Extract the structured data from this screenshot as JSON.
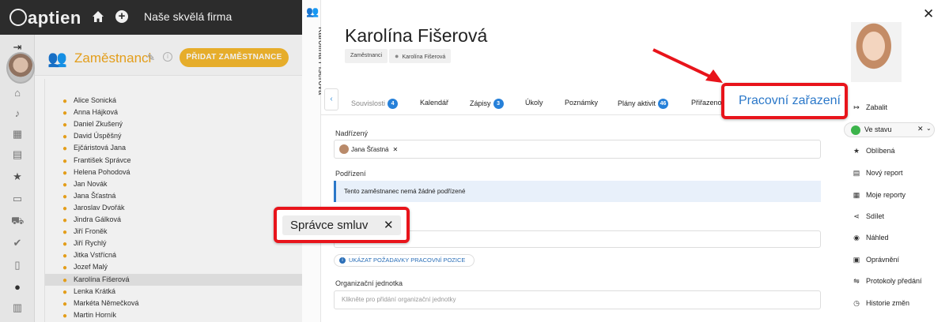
{
  "app": {
    "logo": "aptien",
    "company": "Naše skvělá firma"
  },
  "employees": {
    "title": "Zaměstnanci",
    "add_button": "PŘIDAT ZAMĚSTNANCE",
    "list": [
      "Alice Sonická",
      "Anna Hájková",
      "Daniel Zkušený",
      "David Úspěšný",
      "Ejčáristová Jana",
      "František Správce",
      "Helena Pohodová",
      "Jan Novák",
      "Jana Šťastná",
      "Jaroslav Dvořák",
      "Jindra Gálková",
      "Jiří Froněk",
      "Jiří Rychlý",
      "Jitka Vstřícná",
      "Jozef Malý",
      "Karolína Fišerová",
      "Lenka Krátká",
      "Markéta Němečková",
      "Martin Horník"
    ],
    "selected": "Karolína Fišerová"
  },
  "detail": {
    "vertical_name": "Karolína Fišerová",
    "name": "Karolína Fišerová",
    "breadcrumb": [
      "Zaměstnanci",
      "Karolína Fišerová"
    ],
    "tabs": [
      {
        "label": "Souvislosti",
        "badge": "4"
      },
      {
        "label": "Kalendář",
        "badge": ""
      },
      {
        "label": "Zápisy",
        "badge": "3"
      },
      {
        "label": "Úkoly",
        "badge": ""
      },
      {
        "label": "Poznámky",
        "badge": ""
      },
      {
        "label": "Plány aktivit",
        "badge": "46"
      },
      {
        "label": "Přiřazeno",
        "badge": ""
      }
    ],
    "active_tab": "Pracovní zařazení",
    "supervisor_label": "Nadřízený",
    "supervisor_value": "Jana Šťastná",
    "subordinates_label": "Podřízení",
    "subordinates_notice": "Tento zaměstnanec nemá žádné podřízené",
    "position_value": "Správce smluv",
    "requirements_button": "UKÁZAT POŽADAVKY PRACOVNÍ POZICE",
    "org_unit_label": "Organizační jednotka",
    "org_unit_placeholder": "Klikněte pro přidání organizační jednotky"
  },
  "sidebar": {
    "collapse": "Zabalit",
    "status": "Ve stavu",
    "items": [
      {
        "label": "Oblíbená",
        "icon": "star-icon"
      },
      {
        "label": "Nový report",
        "icon": "report-icon"
      },
      {
        "label": "Moje reporty",
        "icon": "reports-icon"
      },
      {
        "label": "Sdílet",
        "icon": "share-icon"
      },
      {
        "label": "Náhled",
        "icon": "eye-icon"
      },
      {
        "label": "Oprávnění",
        "icon": "permissions-icon"
      },
      {
        "label": "Protokoly předání",
        "icon": "handover-icon"
      },
      {
        "label": "Historie změn",
        "icon": "history-icon"
      }
    ]
  },
  "colors": {
    "accent": "#f2a81d",
    "link": "#2b78c9",
    "highlight": "#e8141b",
    "status_green": "#3cb44b"
  }
}
